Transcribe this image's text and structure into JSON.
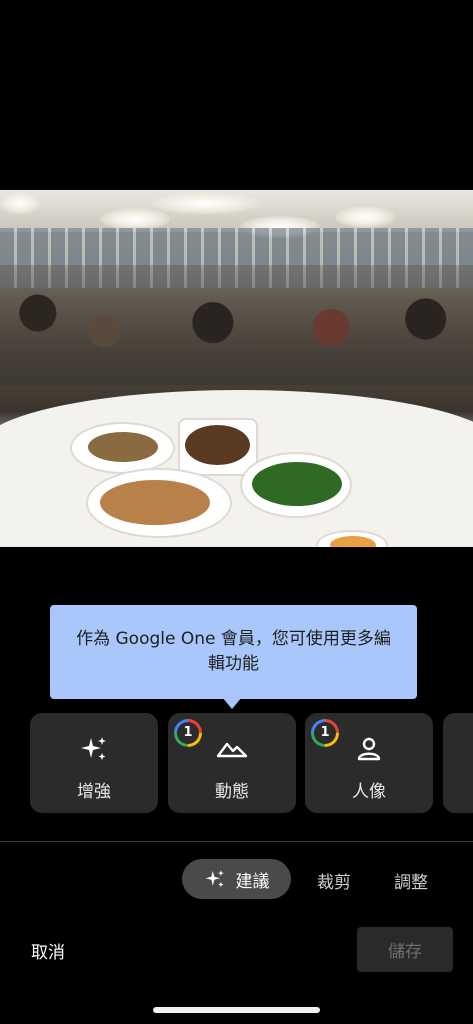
{
  "photo": {
    "description_icon": "restaurant-photo"
  },
  "tooltip": {
    "text": "作為 Google One 會員，您可使用更多編輯功能"
  },
  "tools": [
    {
      "label": "增強",
      "icon": "sparkle-icon",
      "premium": false
    },
    {
      "label": "動態",
      "icon": "mountain-icon",
      "premium": true
    },
    {
      "label": "人像",
      "icon": "portrait-icon",
      "premium": true
    }
  ],
  "premium_badge": "1",
  "tabs": {
    "active": "建議",
    "items": [
      "裁剪",
      "調整"
    ]
  },
  "actions": {
    "cancel": "取消",
    "save": "儲存"
  },
  "colors": {
    "tooltip_bg": "#a9c7fa",
    "card_bg": "#2b2b2b",
    "active_tab_bg": "#4a4a4a"
  }
}
